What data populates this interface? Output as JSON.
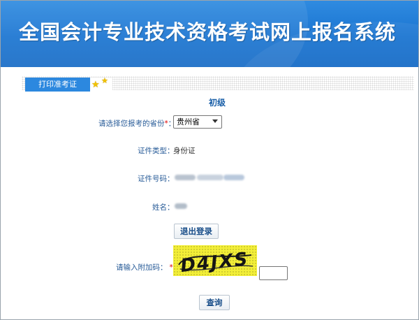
{
  "header": {
    "title": "全国会计专业技术资格考试网上报名系统"
  },
  "tabs": {
    "active": "打印准考证"
  },
  "form": {
    "level": "初级",
    "province_label": "请选择您报考的省份",
    "province_value": "贵州省",
    "id_type_label": "证件类型：",
    "id_type_value": "身份证",
    "id_number_label": "证件号码：",
    "name_label": "姓名：",
    "captcha_label": "请输入附加码：",
    "captcha_text": "D4JXS",
    "required_mark": "*",
    "colon": "：",
    "logout_button": "退出登录",
    "query_button": "查询"
  },
  "icons": {
    "tab_decoration": "star-icon"
  },
  "colors": {
    "header_blue": "#1a74d1",
    "tab_blue": "#2c88df",
    "label_blue": "#2a5d99",
    "captcha_bg": "#f3ef38"
  }
}
